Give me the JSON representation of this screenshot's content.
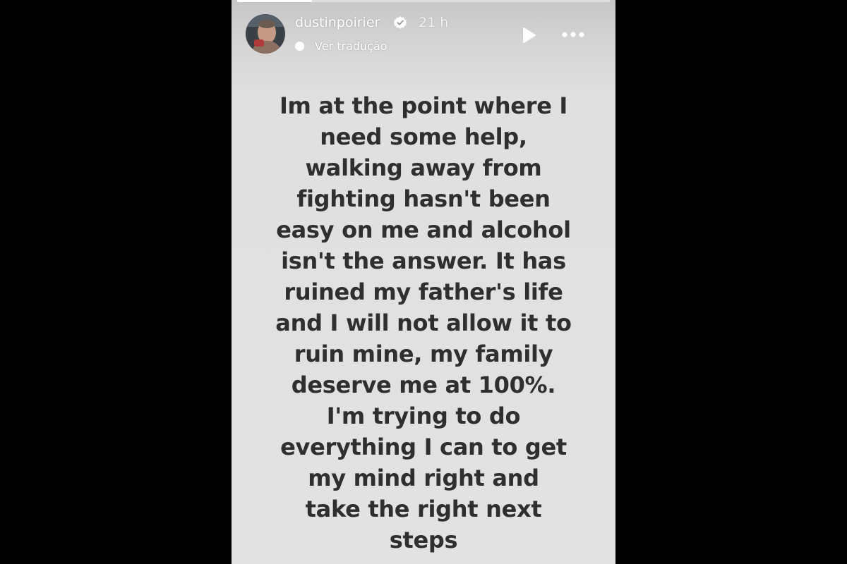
{
  "story": {
    "username": "dustinpoirier",
    "time": "21 h",
    "translate_label": "Ver tradução",
    "progress": 0.2,
    "icons": {
      "verified": "verified-badge-icon",
      "play": "play-icon",
      "more": "more-options-icon",
      "translate": "translate-icon"
    },
    "text_lines": [
      "Im at the point where I",
      "need some help,",
      "walking away from",
      "fighting hasn't been",
      "easy on me and alcohol",
      "isn't the answer. It has",
      "ruined my father's life",
      "and I will not allow it to",
      "ruin mine, my family",
      "deserve me at 100%.",
      "I'm trying to do",
      "everything I can to get",
      "my mind right and",
      "take the right next",
      "steps"
    ]
  },
  "colors": {
    "page_background": "#000000",
    "story_background": "#e2e2e2",
    "text": "#2f2f2f",
    "verified_badge": "#ffffff"
  }
}
